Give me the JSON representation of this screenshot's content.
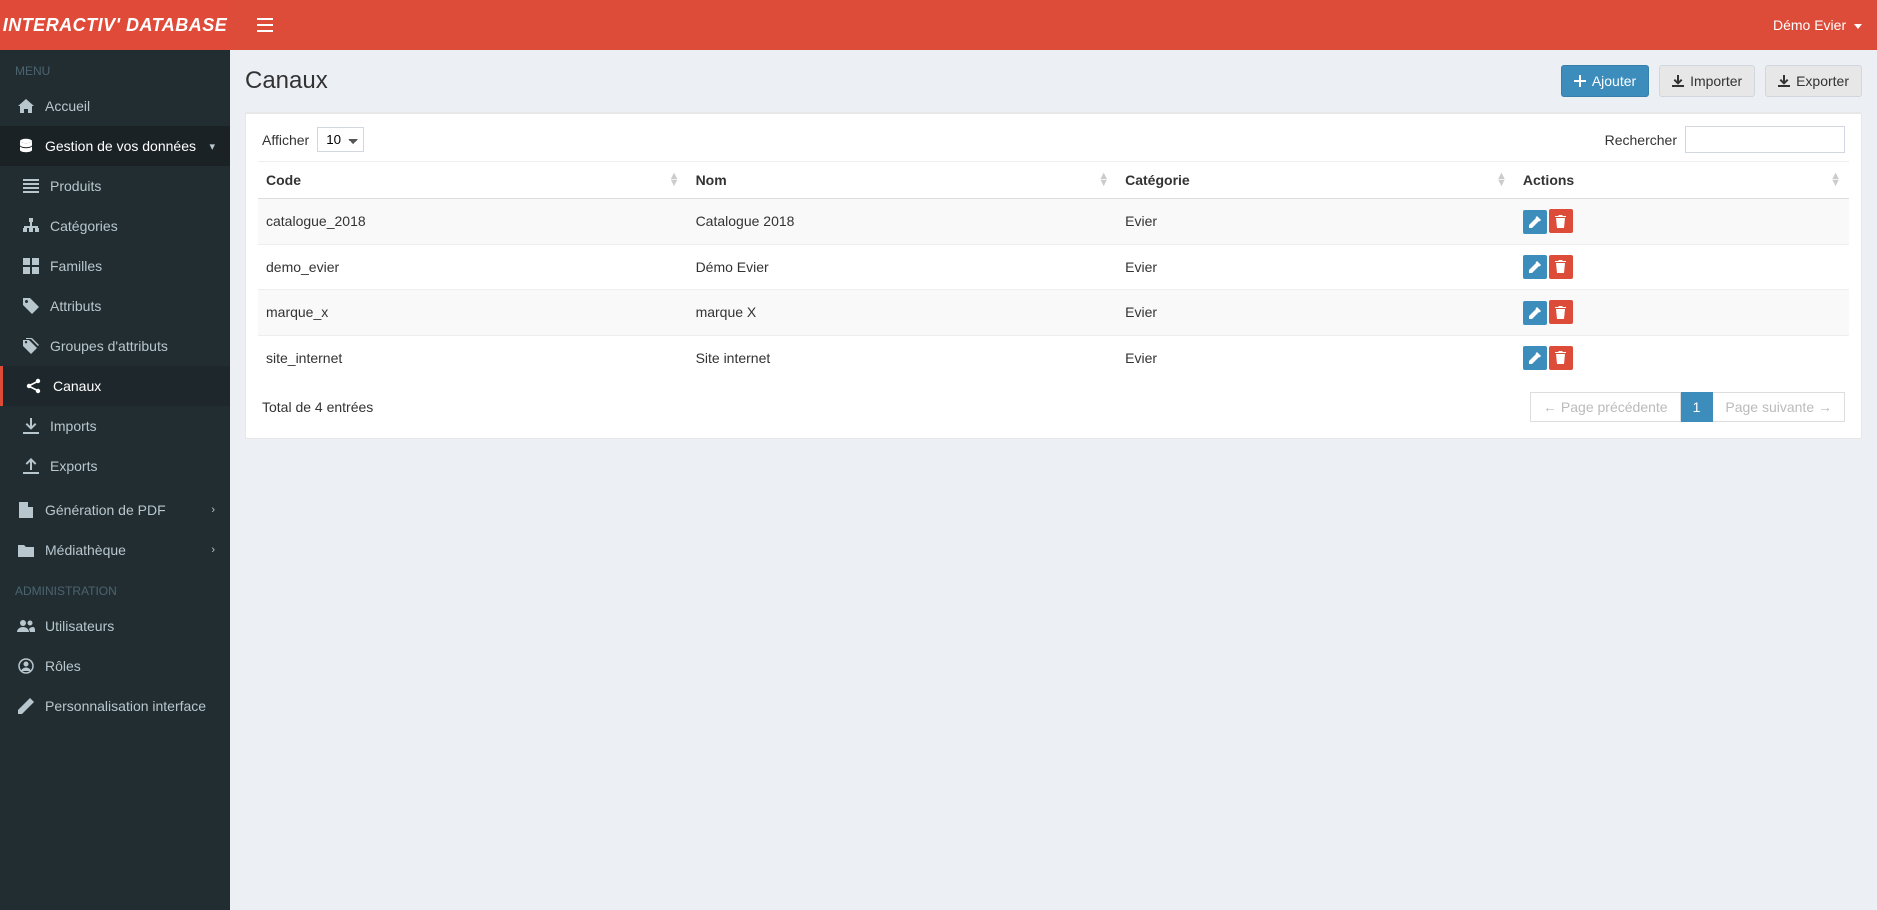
{
  "brand": "INTERACTIV' DATABASE",
  "user": {
    "name": "Démo Evier"
  },
  "sidebar": {
    "section_menu": "MENU",
    "section_admin": "ADMINISTRATION",
    "items": {
      "accueil": "Accueil",
      "gestion": "Gestion de vos données",
      "produits": "Produits",
      "categories": "Catégories",
      "familles": "Familles",
      "attributs": "Attributs",
      "groupes": "Groupes d'attributs",
      "canaux": "Canaux",
      "imports": "Imports",
      "exports": "Exports",
      "genpdf": "Génération de PDF",
      "mediatheque": "Médiathèque",
      "utilisateurs": "Utilisateurs",
      "roles": "Rôles",
      "personnalisation": "Personnalisation interface"
    }
  },
  "page": {
    "title": "Canaux",
    "buttons": {
      "add": "Ajouter",
      "import": "Importer",
      "export": "Exporter"
    }
  },
  "table": {
    "length_label": "Afficher",
    "length_value": "10",
    "search_label": "Rechercher",
    "columns": {
      "code": "Code",
      "nom": "Nom",
      "categorie": "Catégorie",
      "actions": "Actions"
    },
    "rows": [
      {
        "code": "catalogue_2018",
        "nom": "Catalogue 2018",
        "categorie": "Evier"
      },
      {
        "code": "demo_evier",
        "nom": "Démo Evier",
        "categorie": "Evier"
      },
      {
        "code": "marque_x",
        "nom": "marque X",
        "categorie": "Evier"
      },
      {
        "code": "site_internet",
        "nom": "Site internet",
        "categorie": "Evier"
      }
    ],
    "info": "Total de 4 entrées",
    "pagination": {
      "prev": "← Page précédente",
      "current": "1",
      "next": "Page suivante →"
    }
  }
}
